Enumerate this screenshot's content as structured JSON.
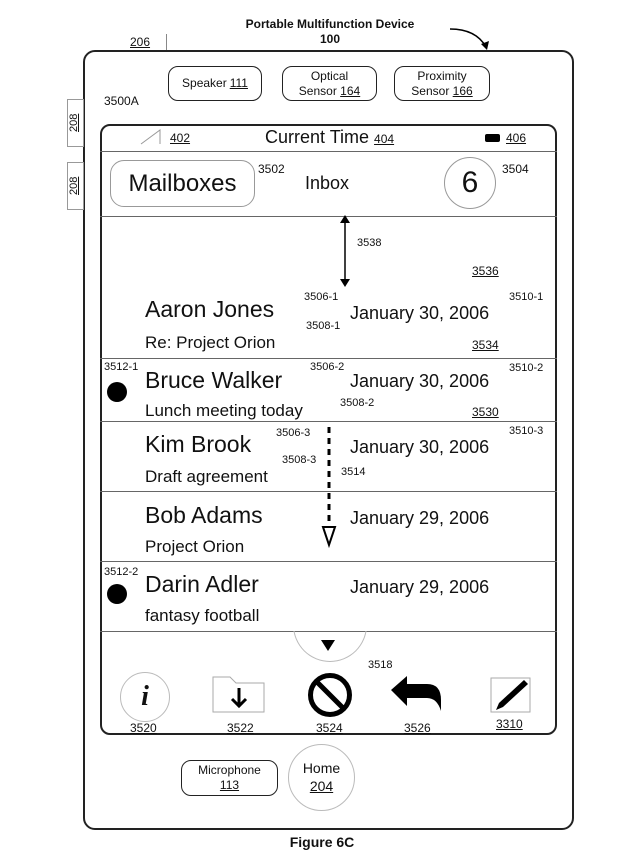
{
  "title": "Portable Multifunction Device",
  "title_ref": "100",
  "figure": "Figure 6C",
  "refs": {
    "device_edge": "206",
    "side_button_1": "208",
    "side_button_2": "208",
    "screen": "3500A",
    "signal": "402",
    "time_ref": "404",
    "battery": "406",
    "mailboxes": "3502",
    "count": "3504",
    "arrow": "3538",
    "r3536": "3536",
    "r3534": "3534",
    "r3530": "3530",
    "gesture": "3514",
    "more": "3518"
  },
  "hardware": {
    "speaker": "Speaker",
    "speaker_ref": "111",
    "optical": "Optical",
    "optical2": "Sensor",
    "optical_ref": "164",
    "proximity": "Proximity",
    "proximity2": "Sensor",
    "proximity_ref": "166",
    "microphone": "Microphone",
    "microphone_ref": "113",
    "home": "Home",
    "home_ref": "204"
  },
  "status": {
    "time": "Current Time"
  },
  "header": {
    "back": "Mailboxes",
    "title": "Inbox",
    "unread": "6"
  },
  "messages": [
    {
      "sender": "Aaron Jones",
      "subject": "Re: Project Orion",
      "date": "January 30, 2006",
      "ref_name": "3506-1",
      "ref_subj": "3508-1",
      "ref_date": "3510-1"
    },
    {
      "sender": "Bruce Walker",
      "subject": "Lunch meeting today",
      "date": "January 30, 2006",
      "ref_name": "3506-2",
      "ref_subj": "3508-2",
      "ref_date": "3510-2",
      "ref_dot": "3512-1"
    },
    {
      "sender": "Kim Brook",
      "subject": "Draft agreement",
      "date": "January 30, 2006",
      "ref_name": "3506-3",
      "ref_subj": "3508-3",
      "ref_date": "3510-3"
    },
    {
      "sender": "Bob Adams",
      "subject": "Project Orion",
      "date": "January 29, 2006"
    },
    {
      "sender": "Darin Adler",
      "subject": "fantasy football",
      "date": "January 29, 2006",
      "ref_dot": "3512-2"
    }
  ],
  "toolbar": [
    {
      "icon": "info-icon",
      "ref": "3520"
    },
    {
      "icon": "move-folder-icon",
      "ref": "3522"
    },
    {
      "icon": "delete-icon",
      "ref": "3524"
    },
    {
      "icon": "reply-icon",
      "ref": "3526"
    },
    {
      "icon": "compose-icon",
      "ref": "3310"
    }
  ]
}
